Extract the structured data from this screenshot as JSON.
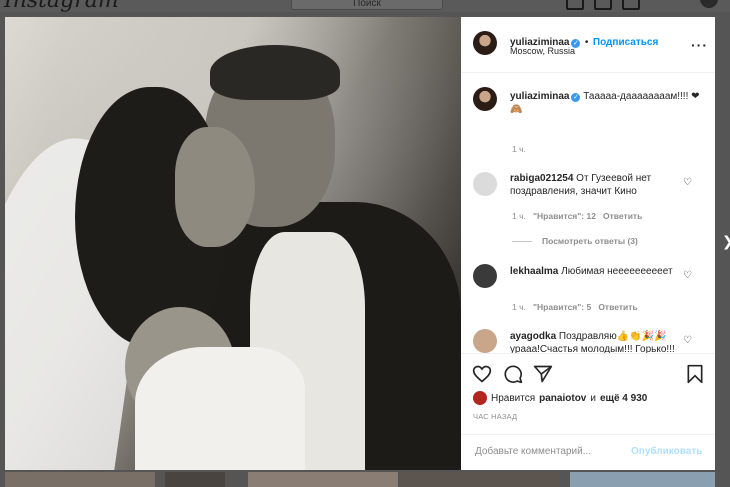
{
  "topbar": {
    "logo": "Instagram",
    "search_placeholder": "Поиск"
  },
  "post": {
    "author": "yuliaziminaa",
    "follow_label": "Подписаться",
    "location": "Moscow, Russia",
    "caption": "Тааааа-даааааааам!!!! ❤🙈",
    "caption_time": "1 ч."
  },
  "comments": [
    {
      "user": "rabiga021254",
      "text": "От Гузеевой нет поздравления, значит Кино",
      "time": "1 ч.",
      "likes": "\"Нравится\": 12",
      "reply": "Ответить",
      "view_replies": "Посмотреть ответы (3)"
    },
    {
      "user": "lekhaalma",
      "text": "Любимая неееееееееет",
      "time": "1 ч.",
      "likes": "\"Нравится\": 5",
      "reply": "Ответить"
    },
    {
      "user": "ayagodka",
      "text": "Поздравляю👍👏🎉🎉урааа!Счастья молодым!!! Горько!!!"
    }
  ],
  "likes_row": {
    "prefix": "Нравится",
    "user": "panaiotov",
    "conj": "и",
    "rest": "ещё 4 930"
  },
  "timestamp": "ЧАС НАЗАД",
  "add_comment": {
    "placeholder": "Добавьте комментарий...",
    "publish": "Опубликовать"
  },
  "colors": {
    "accent": "#0095f6",
    "verified": "#3897f0",
    "publish_disabled": "#b2dffc",
    "muted": "#8e8e8e"
  }
}
